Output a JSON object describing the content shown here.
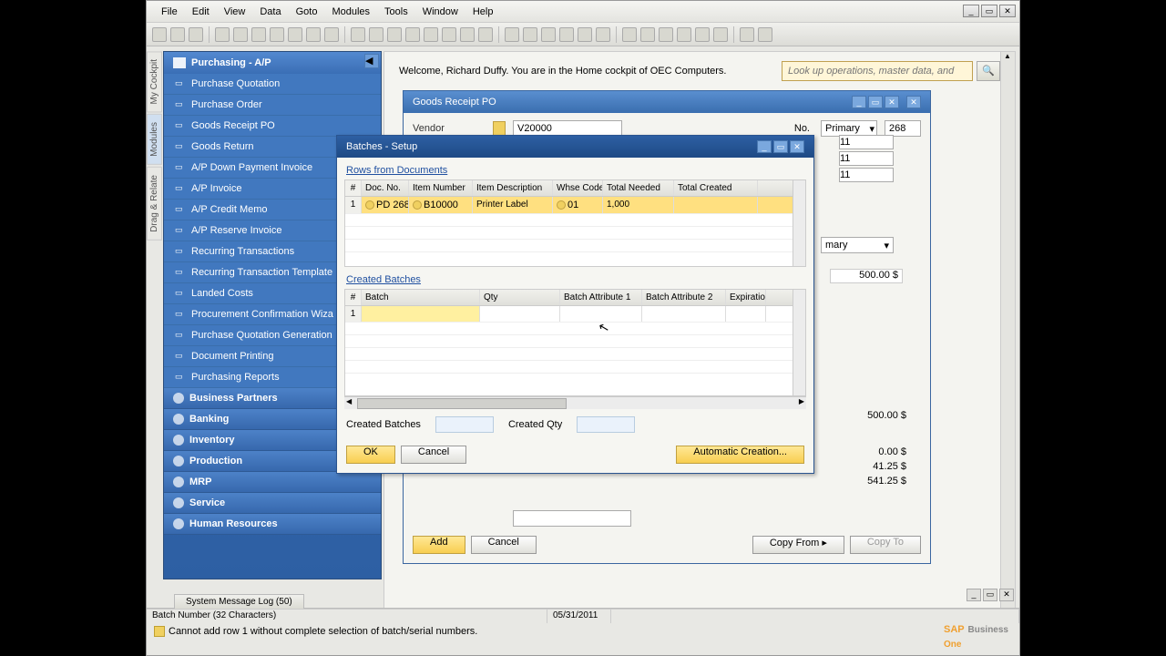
{
  "menu": {
    "file": "File",
    "edit": "Edit",
    "view": "View",
    "data": "Data",
    "goto": "Goto",
    "modules": "Modules",
    "tools": "Tools",
    "window": "Window",
    "help": "Help"
  },
  "vtabs": {
    "cockpit": "My Cockpit",
    "modules": "Modules",
    "drag": "Drag & Relate"
  },
  "sidebar": {
    "title": "Purchasing - A/P",
    "items": [
      "Purchase Quotation",
      "Purchase Order",
      "Goods Receipt PO",
      "Goods Return",
      "A/P Down Payment Invoice",
      "A/P Invoice",
      "A/P Credit Memo",
      "A/P Reserve Invoice",
      "Recurring Transactions",
      "Recurring Transaction Template",
      "Landed Costs",
      "Procurement Confirmation Wiza",
      "Purchase Quotation Generation",
      "Document Printing",
      "Purchasing Reports"
    ],
    "cats": [
      "Business Partners",
      "Banking",
      "Inventory",
      "Production",
      "MRP",
      "Service",
      "Human Resources"
    ]
  },
  "welcome": "Welcome, Richard Duffy. You are in the Home cockpit of OEC Computers.",
  "search": {
    "placeholder": "Look up operations, master data, and"
  },
  "grpo": {
    "title": "Goods Receipt PO",
    "vendor_label": "Vendor",
    "vendor": "V20000",
    "no_label": "No.",
    "no_type": "Primary",
    "no_val": "268",
    "dates": [
      "11",
      "11",
      "11"
    ],
    "summary": "mary",
    "amt1": "500.00 $",
    "total1": "500.00 $",
    "l1": "0.00 $",
    "l2": "41.25 $",
    "l3": "541.25 $",
    "add": "Add",
    "cancel": "Cancel",
    "copyfrom": "Copy From",
    "copyto": "Copy To"
  },
  "batches": {
    "title": "Batches - Setup",
    "rows_from": "Rows from Documents",
    "cols1": {
      "num": "#",
      "doc": "Doc. No.",
      "item": "Item Number",
      "desc": "Item Description",
      "whse": "Whse Code",
      "need": "Total Needed",
      "created": "Total Created"
    },
    "row": {
      "num": "1",
      "doc": "PD 268",
      "item": "B10000",
      "desc": "Printer Label",
      "whse": "01",
      "need": "1,000",
      "created": ""
    },
    "created_label": "Created Batches",
    "cols2": {
      "num": "#",
      "batch": "Batch",
      "qty": "Qty",
      "ba1": "Batch Attribute 1",
      "ba2": "Batch Attribute 2",
      "exp": "Expiratio..."
    },
    "row2": {
      "num": "1"
    },
    "created_batches_label": "Created Batches",
    "created_qty_label": "Created Qty",
    "ok": "OK",
    "cancel": "Cancel",
    "auto": "Automatic Creation..."
  },
  "status": {
    "tab": "System Message Log (50)",
    "field": "Batch Number (32 Characters)",
    "date": "05/31/2011",
    "msg": "Cannot add row 1 without complete selection of batch/serial numbers.",
    "brand1": "SAP",
    "brand2": "Business",
    "brand3": "One"
  }
}
